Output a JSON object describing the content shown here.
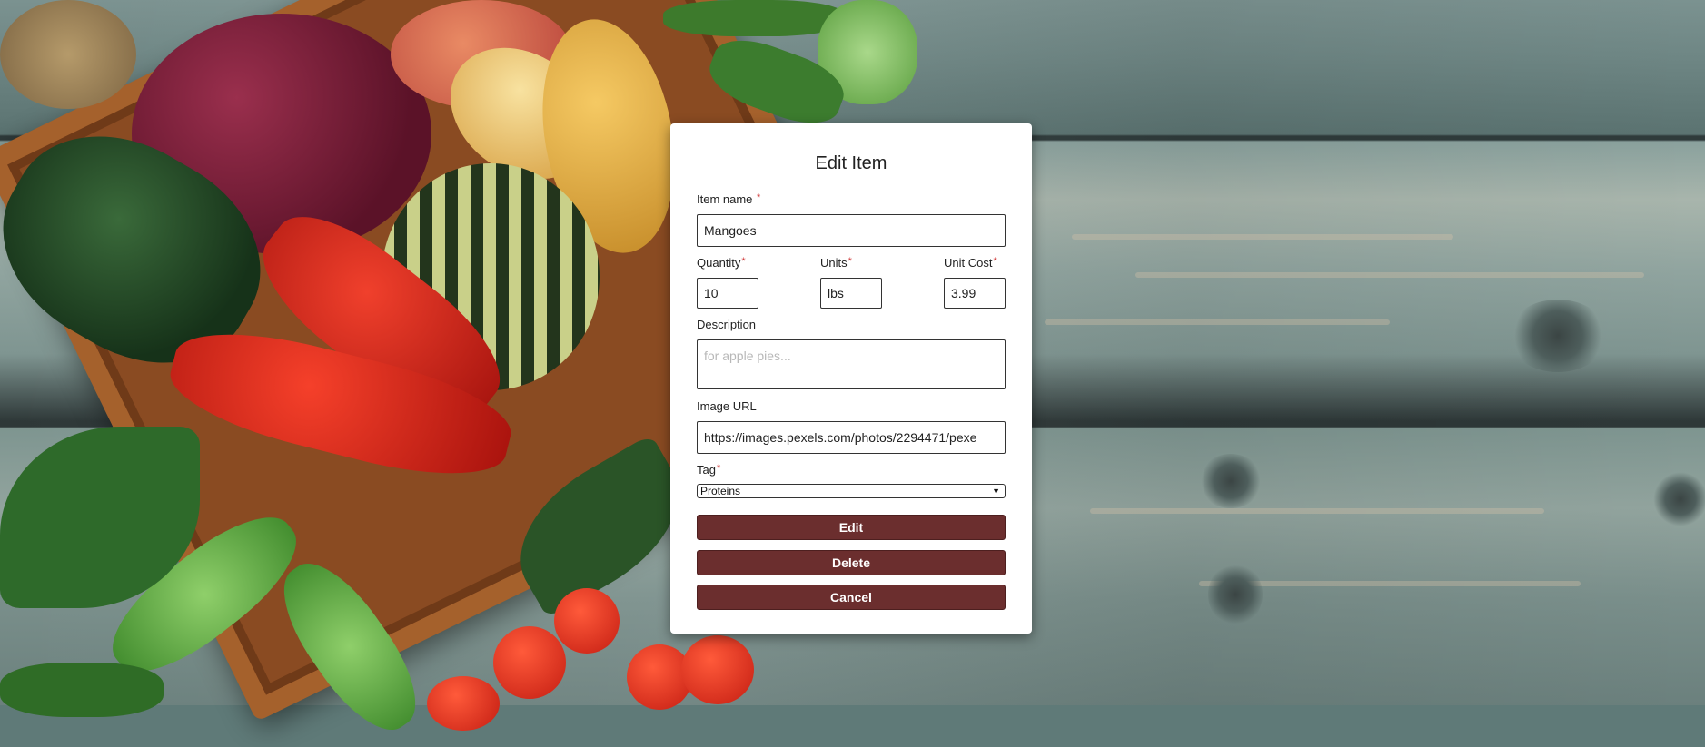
{
  "modal": {
    "title": "Edit Item",
    "item_name": {
      "label": "Item name",
      "required_mark": "*",
      "value": "Mangoes"
    },
    "quantity": {
      "label": "Quantity",
      "required_mark": "*",
      "value": "10"
    },
    "units": {
      "label": "Units",
      "required_mark": "*",
      "value": "lbs"
    },
    "unit_cost": {
      "label": "Unit Cost",
      "required_mark": "*",
      "value": "3.99"
    },
    "description": {
      "label": "Description",
      "value": "",
      "placeholder": "for apple pies..."
    },
    "image_url": {
      "label": "Image URL",
      "value": "https://images.pexels.com/photos/2294471/pexe"
    },
    "tag": {
      "label": "Tag",
      "required_mark": "*",
      "selected": "Proteins",
      "arrow": "▼"
    },
    "buttons": {
      "edit": "Edit",
      "delete": "Delete",
      "cancel": "Cancel"
    }
  },
  "colors": {
    "button_bg": "#6b2e2e",
    "required_mark": "#d03b3b",
    "modal_bg": "#ffffff"
  }
}
